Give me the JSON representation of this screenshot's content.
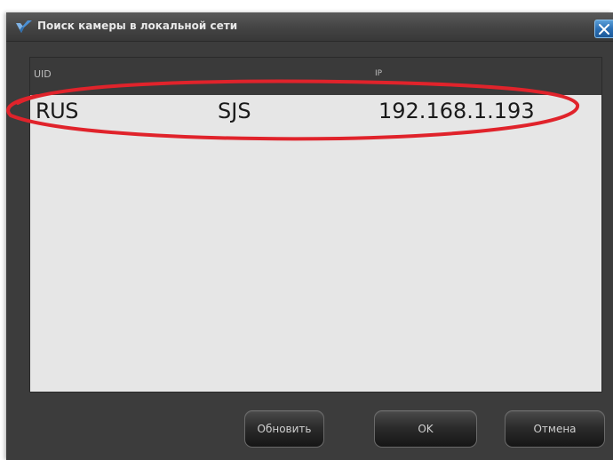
{
  "window": {
    "title": "Поиск камеры в локальной сети"
  },
  "list": {
    "columns": [
      "UID",
      "IP"
    ],
    "rows": [
      {
        "uid_visible_start": "RUS",
        "uid_visible_end": "SJS",
        "ip": "192.168.1.193"
      }
    ]
  },
  "buttons": {
    "refresh": "Обновить",
    "ok": "OK",
    "cancel": "Отмена"
  },
  "colors": {
    "window_bg": "#3c3c3c",
    "list_bg": "#e6e6e6",
    "header_bg": "#3a3a3a",
    "highlight": "#e0232b",
    "close_btn": "#2b6fb4"
  },
  "icons": {
    "app": "v-logo-icon",
    "close": "close-icon"
  }
}
